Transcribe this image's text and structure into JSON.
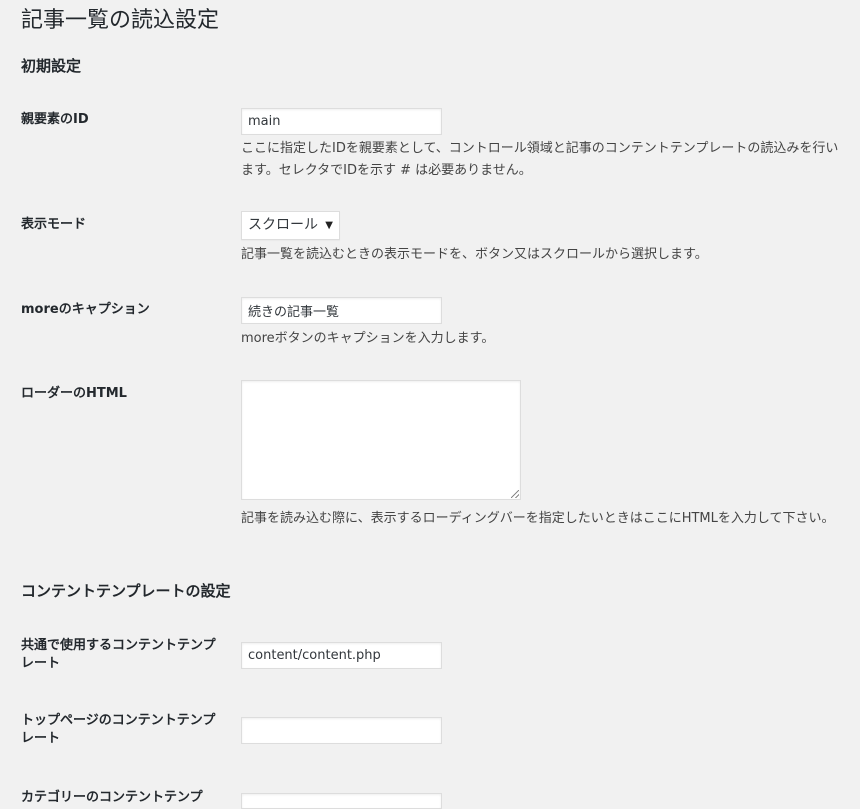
{
  "page": {
    "title": "記事一覧の読込設定"
  },
  "sections": {
    "initial": {
      "title": "初期設定",
      "parent_id": {
        "label": "親要素のID",
        "value": "main",
        "description": "ここに指定したIDを親要素として、コントロール領域と記事のコンテントテンプレートの読込みを行います。セレクタでIDを示す # は必要ありません。"
      },
      "display_mode": {
        "label": "表示モード",
        "selected": "スクロール",
        "description": "記事一覧を読込むときの表示モードを、ボタン又はスクロールから選択します。"
      },
      "more_caption": {
        "label": "moreのキャプション",
        "value": "続きの記事一覧",
        "description": "moreボタンのキャプションを入力します。"
      },
      "loader_html": {
        "label": "ローダーのHTML",
        "value": "",
        "description": "記事を読み込む際に、表示するローディングバーを指定したいときはここにHTMLを入力して下さい。"
      }
    },
    "content_template": {
      "title": "コンテントテンプレートの設定",
      "common": {
        "label": "共通で使用するコンテントテンプレート",
        "value": "content/content.php"
      },
      "top_page": {
        "label": "トップページのコンテントテンプレート",
        "value": ""
      },
      "category": {
        "label": "カテゴリーのコンテントテンプ",
        "value": ""
      }
    }
  }
}
